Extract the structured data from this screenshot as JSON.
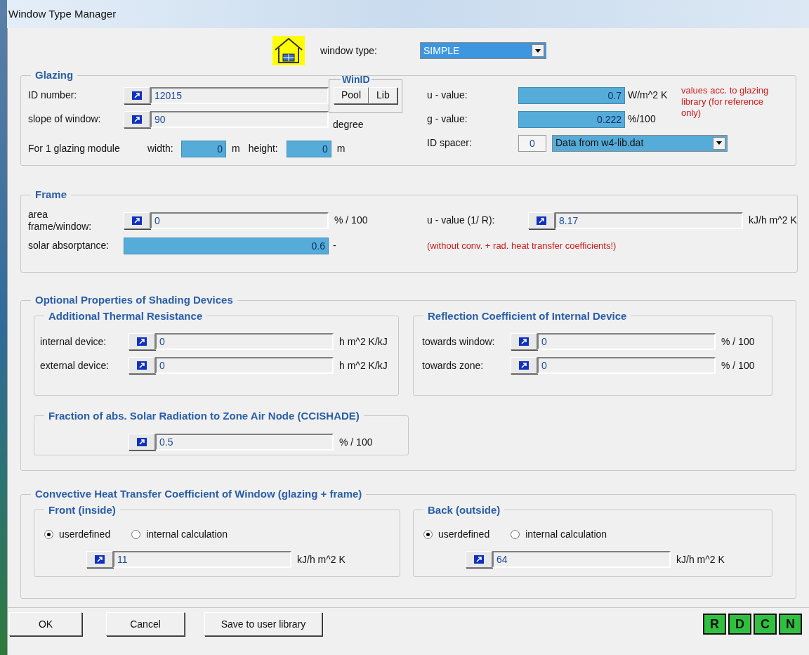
{
  "window": {
    "title": "Window Type Manager"
  },
  "window_type": {
    "label": "window type:",
    "value": "SIMPLE"
  },
  "glazing": {
    "title": "Glazing",
    "id_number": {
      "label": "ID number:",
      "value": "12015",
      "filled": false
    },
    "slope": {
      "label": "slope of window:",
      "value": "90",
      "unit": "degree",
      "filled": false
    },
    "module": {
      "label": "For 1 glazing module",
      "width": {
        "label": "width:",
        "value": "0",
        "unit": "m",
        "filled": true
      },
      "height": {
        "label": "height:",
        "value": "0",
        "unit": "m",
        "filled": true
      }
    },
    "winid": {
      "title": "WinID",
      "buttons": [
        "Pool",
        "Lib"
      ]
    },
    "u_value": {
      "label": "u - value:",
      "value": "0.7",
      "unit": "W/m^2 K",
      "filled": true
    },
    "g_value": {
      "label": "g - value:",
      "value": "0.222",
      "unit": "%/100",
      "filled": true
    },
    "note": "values acc. to glazing library (for reference only)",
    "spacer": {
      "label": "ID spacer:",
      "id": "0",
      "value": "Data from w4-lib.dat"
    }
  },
  "frame": {
    "title": "Frame",
    "area": {
      "label": "area frame/window:",
      "value": "0",
      "unit": "% / 100",
      "filled": false
    },
    "solar_absorptance": {
      "label": "solar absorptance:",
      "value": "0.6",
      "unit": "-",
      "filled": true
    },
    "u_value": {
      "label": "u - value (1/ R):",
      "value": "8.17",
      "unit": "kJ/h m^2 K",
      "filled": false
    },
    "note": "(without conv. + rad. heat transfer coefficients!)"
  },
  "shading": {
    "title": "Optional Properties of Shading Devices",
    "thermal_resistance": {
      "title": "Additional Thermal Resistance",
      "rows": [
        {
          "label": "internal device:",
          "value": "0",
          "unit": "h m^2 K/kJ",
          "filled": false
        },
        {
          "label": "external device:",
          "value": "0",
          "unit": "h m^2 K/kJ",
          "filled": false
        }
      ]
    },
    "reflection": {
      "title": "Reflection Coefficient of Internal Device",
      "rows": [
        {
          "label": "towards window:",
          "value": "0",
          "unit": "% / 100",
          "filled": false
        },
        {
          "label": "towards zone:",
          "value": "0",
          "unit": "% / 100",
          "filled": false
        }
      ]
    },
    "fraction": {
      "title": "Fraction of abs. Solar Radiation to Zone Air Node (CCISHADE)",
      "value": "0.5",
      "unit": "% / 100",
      "filled": false
    }
  },
  "convective": {
    "title": "Convective Heat Transfer Coefficient of Window (glazing + frame)",
    "sides": [
      {
        "title": "Front (inside)",
        "options": [
          {
            "label": "userdefined",
            "selected": true
          },
          {
            "label": "internal calculation",
            "selected": false
          }
        ],
        "value": "11",
        "unit": "kJ/h m^2 K",
        "filled": false
      },
      {
        "title": "Back (outside)",
        "options": [
          {
            "label": "userdefined",
            "selected": true
          },
          {
            "label": "internal calculation",
            "selected": false
          }
        ],
        "value": "64",
        "unit": "kJ/h m^2 K",
        "filled": false
      }
    ]
  },
  "buttons": [
    "OK",
    "Cancel",
    "Save to user library"
  ],
  "mode_buttons": [
    "R",
    "D",
    "C",
    "N"
  ]
}
